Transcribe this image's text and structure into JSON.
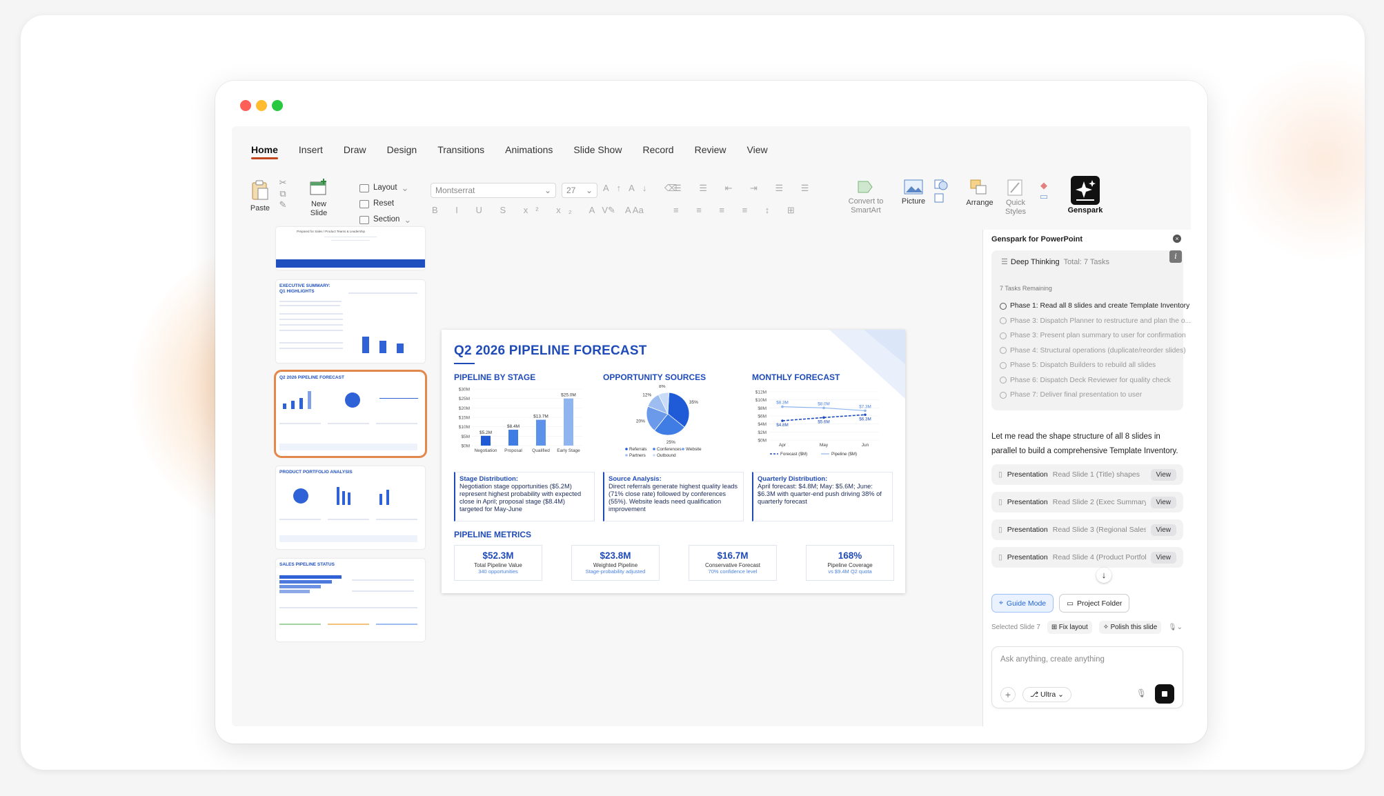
{
  "tabs": [
    "Home",
    "Insert",
    "Draw",
    "Design",
    "Transitions",
    "Animations",
    "Slide Show",
    "Record",
    "Review",
    "View"
  ],
  "ribbon": {
    "paste": "Paste",
    "new_slide": "New Slide",
    "layout": "Layout",
    "reset": "Reset",
    "section": "Section",
    "font": "Montserrat",
    "font_size": "27",
    "convert": "Convert to SmartArt",
    "picture": "Picture",
    "arrange": "Arrange",
    "quick_styles": "Quick Styles",
    "genspark": "Genspark"
  },
  "thumbnails": {
    "t1_line": "Prepared for Sales / Product Teams & Leadership",
    "t2_title": "EXECUTIVE SUMMARY: Q1 HIGHLIGHTS",
    "t3_title": "Q2 2026 PIPELINE FORECAST",
    "t4_title": "PRODUCT PORTFOLIO ANALYSIS",
    "t5_title": "SALES PIPELINE STATUS"
  },
  "slide": {
    "title": "Q2 2026 PIPELINE FORECAST",
    "sec1": "PIPELINE BY STAGE",
    "sec2": "OPPORTUNITY SOURCES",
    "sec3": "MONTHLY FORECAST",
    "box1_title": "Stage Distribution:",
    "box1_text": "Negotiation stage opportunities ($5.2M) represent highest probability with expected close in April; proposal stage ($8.4M) targeted for May-June",
    "box2_title": "Source Analysis:",
    "box2_text": "Direct referrals generate highest quality leads (71% close rate) followed by conferences (55%). Website leads need qualification improvement",
    "box3_title": "Quarterly Distribution:",
    "box3_text": "April forecast: $4.8M; May: $5.6M; June: $6.3M with quarter-end push driving 38% of quarterly forecast",
    "metrics_title": "PIPELINE METRICS",
    "metrics": [
      {
        "value": "$52.3M",
        "label": "Total Pipeline Value",
        "sub": "340 opportunities"
      },
      {
        "value": "$23.8M",
        "label": "Weighted Pipeline",
        "sub": "Stage-probability adjusted"
      },
      {
        "value": "$16.7M",
        "label": "Conservative Forecast",
        "sub": "70% confidence level"
      },
      {
        "value": "168%",
        "label": "Pipeline Coverage",
        "sub": "vs $9.4M Q2 quota"
      }
    ]
  },
  "chart_data": [
    {
      "type": "bar",
      "title": "PIPELINE BY STAGE",
      "categories": [
        "Negotiation",
        "Proposal",
        "Qualified",
        "Early Stage"
      ],
      "values": [
        5.2,
        8.4,
        13.7,
        25.0
      ],
      "data_labels": [
        "$5.2M",
        "$8.4M",
        "$13.7M",
        "$25.0M"
      ],
      "y_ticks": [
        "$0M",
        "$5M",
        "$10M",
        "$15M",
        "$20M",
        "$25M",
        "$30M"
      ],
      "ylim": [
        0,
        30
      ]
    },
    {
      "type": "pie",
      "title": "OPPORTUNITY SOURCES",
      "labels": [
        "Referrals",
        "Conferences",
        "Website",
        "Partners",
        "Outbound"
      ],
      "values": [
        35,
        25,
        20,
        12,
        8
      ],
      "data_labels": [
        "35%",
        "25%",
        "20%",
        "12%",
        "8%"
      ],
      "colors": [
        "#1f5bd6",
        "#3f7ce3",
        "#6a9ae9",
        "#9dbdf0",
        "#c9dbf7"
      ]
    },
    {
      "type": "line",
      "title": "MONTHLY FORECAST",
      "x": [
        "Apr",
        "May",
        "Jun"
      ],
      "series": [
        {
          "name": "Forecast ($M)",
          "values": [
            4.8,
            5.6,
            6.3
          ],
          "data_labels": [
            "$4.8M",
            "$5.6M",
            "$6.3M"
          ]
        },
        {
          "name": "Pipeline ($M)",
          "values": [
            8.3,
            8.0,
            7.3
          ],
          "data_labels": [
            "$8.3M",
            "$8.0M",
            "$7.3M"
          ]
        }
      ],
      "y_ticks": [
        "$0M",
        "$2M",
        "$4M",
        "$6M",
        "$8M",
        "$10M",
        "$12M"
      ],
      "ylim": [
        0,
        12
      ]
    }
  ],
  "panel": {
    "title": "Genspark for PowerPoint",
    "deep_thinking": "Deep Thinking",
    "total": "Total: 7 Tasks",
    "remaining": "7 Tasks Remaining",
    "tasks": [
      "Phase 1: Read all 8 slides and create Template Inventory",
      "Phase 3: Dispatch Planner to restructure and plan the o...",
      "Phase 3: Present plan summary to user for confirmation",
      "Phase 4: Structural operations (duplicate/reorder slides)",
      "Phase 5: Dispatch Builders to rebuild all slides",
      "Phase 6: Dispatch Deck Reviewer for quality check",
      "Phase 7: Deliver final presentation to user"
    ],
    "message": "Let me read the shape structure of all 8 slides in parallel to build a comprehensive Template Inventory.",
    "actions": [
      {
        "name": "Presentation",
        "desc": "Read Slide 1 (Title) shapes",
        "btn": "View"
      },
      {
        "name": "Presentation",
        "desc": "Read Slide 2 (Exec Summary) ...",
        "btn": "View"
      },
      {
        "name": "Presentation",
        "desc": "Read Slide 3 (Regional Sales) ...",
        "btn": "View"
      },
      {
        "name": "Presentation",
        "desc": "Read Slide 4 (Product Portfolio...",
        "btn": "View"
      }
    ],
    "guide_mode": "Guide Mode",
    "project_folder": "Project Folder",
    "selected": "Selected Slide 7",
    "fix_layout": "Fix layout",
    "polish": "Polish this slide",
    "placeholder": "Ask anything, create anything",
    "model": "Ultra"
  }
}
